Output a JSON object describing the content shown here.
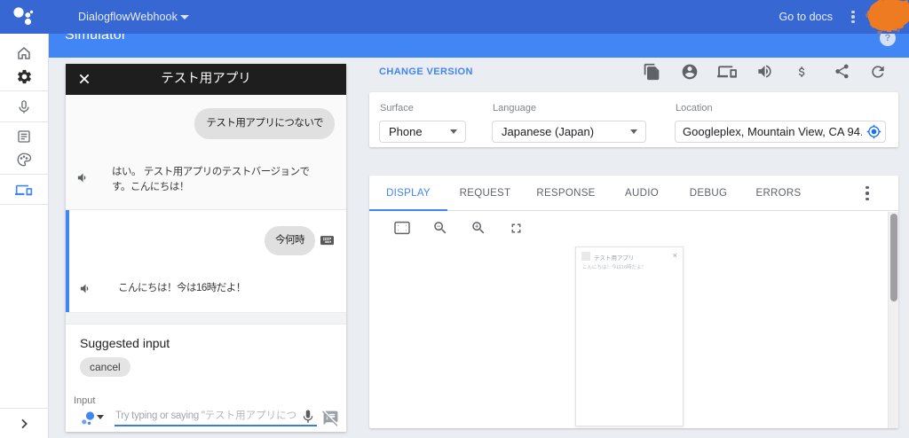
{
  "app_bar": {
    "project_name": "DialogflowWebhook",
    "go_to_docs": "Go to docs"
  },
  "simulator_bar": {
    "title": "Simulator",
    "help": "?"
  },
  "chat": {
    "header_title": "テスト用アプリ",
    "turns": [
      {
        "user": "テスト用アプリにつないで",
        "agent_lines": [
          "はい。 テスト用アプリのテストバージョンで",
          "す。こんにちは！"
        ]
      },
      {
        "user": "今何時",
        "agent_lines": [
          "こんにちは！今は16時だよ！"
        ]
      }
    ],
    "suggested_label": "Suggested input",
    "chips": [
      "cancel"
    ],
    "input_label": "Input",
    "placeholder_prefix": "Try typing or saying \"",
    "placeholder_jp": "テスト用アプリにつな"
  },
  "version_bar": {
    "change_version": "CHANGE VERSION"
  },
  "settings": {
    "surface_label": "Surface",
    "surface_value": "Phone",
    "language_label": "Language",
    "language_value": "Japanese (Japan)",
    "location_label": "Location",
    "location_value": "Googleplex, Mountain View, CA 94.."
  },
  "tabs": {
    "items": [
      "DISPLAY",
      "REQUEST",
      "RESPONSE",
      "AUDIO",
      "DEBUG",
      "ERRORS"
    ],
    "active": "DISPLAY"
  },
  "preview": {
    "title": "テスト用アプリ",
    "close": "×",
    "message": "こんにちは！今は16時だよ！"
  },
  "colors": {
    "appbar": "#3767d2",
    "simbar": "#4285f4",
    "accent": "#4285f4",
    "redaction": "#ef7b22"
  }
}
